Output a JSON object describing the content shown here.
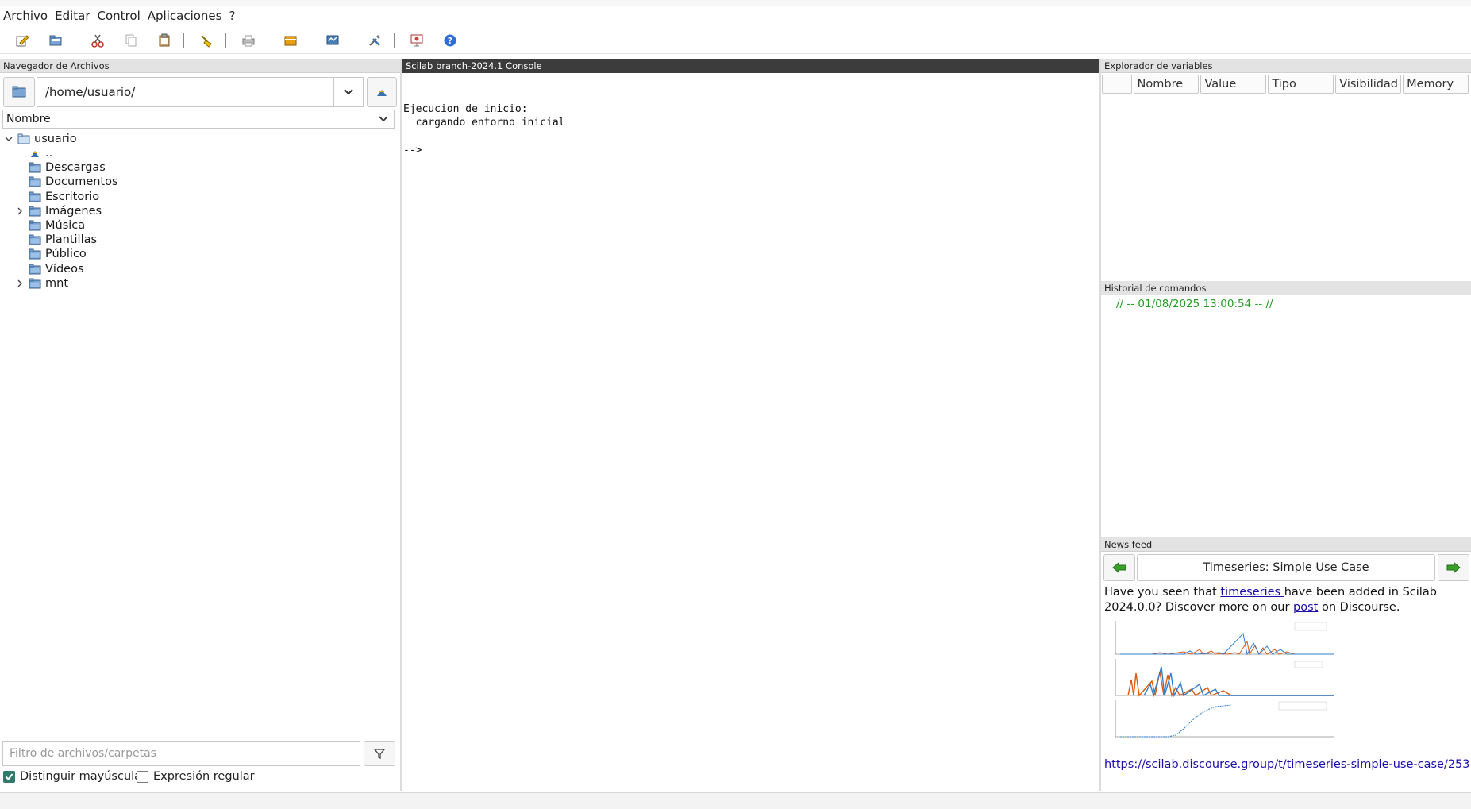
{
  "menu": {
    "items": [
      {
        "text": "Archivo",
        "accel": "A"
      },
      {
        "text": "Editar",
        "accel": "E"
      },
      {
        "text": "Control",
        "accel": "C"
      },
      {
        "text": "Aplicaciones",
        "accel": "p"
      },
      {
        "text": "?",
        "accel": "?"
      }
    ]
  },
  "toolbar": {
    "icons": [
      "new-script-icon",
      "open-file-icon",
      "cut-icon",
      "copy-icon",
      "paste-icon",
      "clear-console-icon",
      "print-icon",
      "module-manager-icon",
      "xcos-icon",
      "preferences-icon",
      "demonstrations-icon",
      "help-icon"
    ]
  },
  "file_browser": {
    "title": "Navegador de Archivos",
    "path": "/home/usuario/",
    "sort_label": "Nombre",
    "root": "usuario",
    "items": [
      {
        "label": "..",
        "expandable": false,
        "kind": "up"
      },
      {
        "label": "Descargas",
        "expandable": false,
        "kind": "folder"
      },
      {
        "label": "Documentos",
        "expandable": false,
        "kind": "folder"
      },
      {
        "label": "Escritorio",
        "expandable": false,
        "kind": "folder"
      },
      {
        "label": "Imágenes",
        "expandable": true,
        "kind": "folder"
      },
      {
        "label": "Música",
        "expandable": false,
        "kind": "folder"
      },
      {
        "label": "Plantillas",
        "expandable": false,
        "kind": "folder"
      },
      {
        "label": "Público",
        "expandable": false,
        "kind": "folder"
      },
      {
        "label": "Vídeos",
        "expandable": false,
        "kind": "folder"
      },
      {
        "label": "mnt",
        "expandable": true,
        "kind": "folder"
      }
    ],
    "filter_placeholder": "Filtro de archivos/carpetas",
    "case_sensitive_label": "Distinguir mayúsculas",
    "case_sensitive_checked": true,
    "regex_label": "Expresión regular",
    "regex_checked": false
  },
  "console": {
    "title": "Scilab branch-2024.1 Console",
    "lines": [
      "Ejecucion de inicio:",
      "  cargando entorno inicial"
    ],
    "prompt": "-->"
  },
  "variables": {
    "title": "Explorador de variables",
    "columns": [
      "",
      "Nombre",
      "Value",
      "Tipo",
      "Visibilidad",
      "Memory"
    ]
  },
  "history": {
    "title": "Historial de comandos",
    "entry": "// -- 01/08/2025 13:00:54 -- //"
  },
  "news": {
    "title": "News feed",
    "headline": "Timeseries: Simple Use Case",
    "body_pre": "Have you seen that ",
    "body_link1": "timeseries ",
    "body_mid": "have been added in Scilab 2024.0.0? Discover more on our ",
    "body_link2": "post",
    "body_post": " on Discourse.",
    "url": "https://scilab.discourse.group/t/timeseries-simple-use-case/253"
  },
  "colors": {
    "console_header": "#3c3c3c",
    "history_green": "#22a022",
    "link_blue": "#1a0dab",
    "checkbox_teal": "#2f7a6b"
  }
}
